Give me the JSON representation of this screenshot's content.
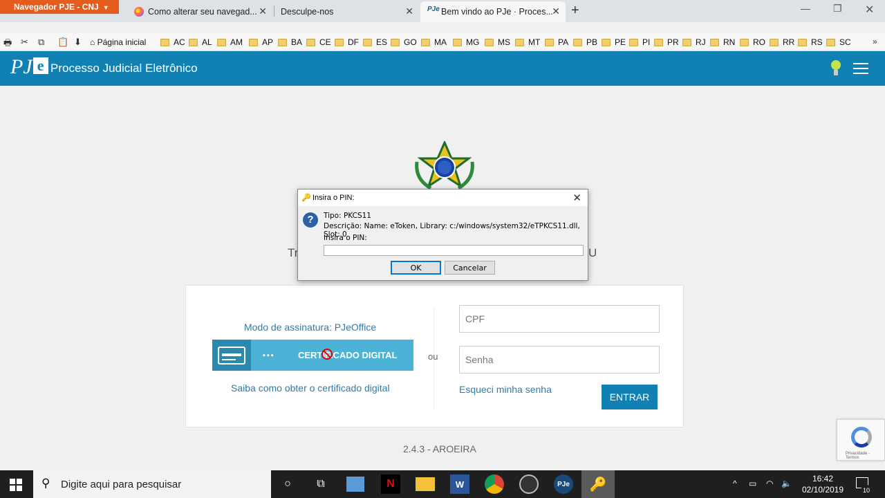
{
  "browser": {
    "app_menu": "Navegador PJE - CNJ",
    "tabs": [
      {
        "title": "Como alterar seu navegad..."
      },
      {
        "title": "Desculpe-nos"
      },
      {
        "title": "Bem vindo ao PJe · Proces..."
      }
    ],
    "toolbar": {
      "home_label": "Página inicial"
    },
    "bookmarks": [
      "AC",
      "AL",
      "AM",
      "AP",
      "BA",
      "CE",
      "DF",
      "ES",
      "GO",
      "MA",
      "MG",
      "MS",
      "MT",
      "PA",
      "PB",
      "PE",
      "PI",
      "PR",
      "RJ",
      "RN",
      "RO",
      "RR",
      "RS",
      "SC"
    ]
  },
  "header": {
    "logo_pj": "PJ",
    "logo_e": "e",
    "title": "Processo Judicial Eletrônico"
  },
  "content": {
    "partial_left": "Tr",
    "partial_right": "U",
    "mode_label": "Modo de assinatura: PJeOffice",
    "cert_dots": "▪▪▪",
    "cert_button": "CERTIFICADO DIGITAL",
    "cert_help": "Saiba como obter o certificado digital",
    "or": "ou",
    "cpf_placeholder": "CPF",
    "password_placeholder": "Senha",
    "forgot": "Esqueci minha senha",
    "enter": "ENTRAR",
    "version": "2.4.3 - AROEIRA",
    "recaptcha_text": "Privacidade - Termos"
  },
  "dialog": {
    "title": "Insira o PIN:",
    "type_line": "Tipo: PKCS11",
    "desc_line": "Descrição: Name: eToken, Library: c:/windows/system32/eTPKCS11.dll, Slot: 0",
    "pin_label": "Insira o PIN:",
    "ok": "OK",
    "cancel": "Cancelar"
  },
  "taskbar": {
    "search_placeholder": "Digite aqui para pesquisar",
    "time": "16:42",
    "date": "02/10/2019",
    "notification_count": "10"
  },
  "colors": {
    "header_blue": "#1181b4",
    "cert_light": "#4db3d6",
    "cert_dark": "#2b89ad",
    "app_menu_orange": "#e55c1f"
  }
}
